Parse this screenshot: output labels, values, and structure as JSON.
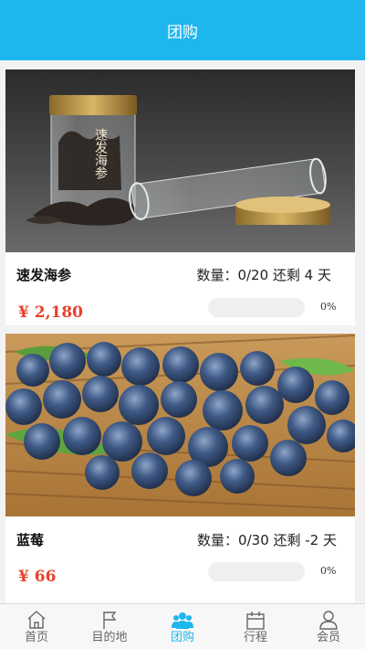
{
  "header": {
    "title": "团购"
  },
  "products": [
    {
      "name": "速发海参",
      "quantity_text": "数量：0/20 还剩 4 天",
      "price": "¥ 2,180",
      "progress_text": "0%",
      "progress": 0,
      "image_label": "速发海参"
    },
    {
      "name": "蓝莓",
      "quantity_text": "数量：0/30 还剩 -2 天",
      "price": "¥ 66",
      "progress_text": "0%",
      "progress": 0
    }
  ],
  "tabbar": {
    "items": [
      {
        "label": "首页",
        "icon": "home-icon"
      },
      {
        "label": "目的地",
        "icon": "flag-icon"
      },
      {
        "label": "团购",
        "icon": "group-icon",
        "active": true
      },
      {
        "label": "行程",
        "icon": "calendar-icon"
      },
      {
        "label": "会员",
        "icon": "user-icon"
      }
    ]
  },
  "colors": {
    "accent": "#1eb6ee",
    "price": "#e8412b"
  }
}
